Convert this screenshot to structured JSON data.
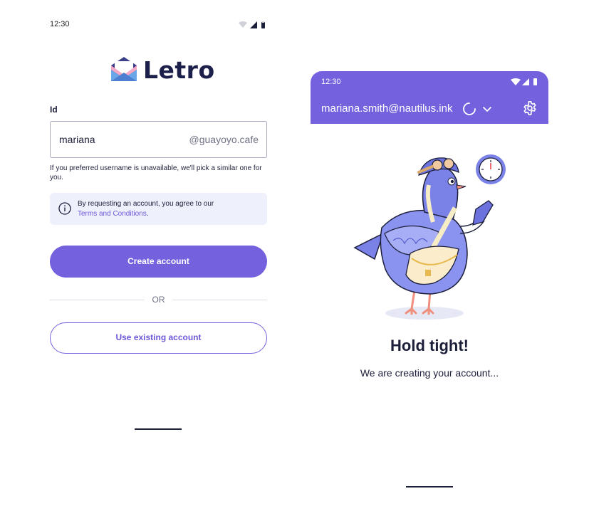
{
  "left_screen": {
    "status_bar": {
      "time": "12:30",
      "icons": [
        "wifi-icon",
        "signal-icon",
        "battery-icon"
      ]
    },
    "brand": {
      "name": "Letro"
    },
    "form": {
      "id_label": "Id",
      "username_value": "mariana",
      "domain_suffix": "@guayoyo.cafe",
      "helper_text": "If you preferred username is unavailable, we'll pick a similar one for you."
    },
    "notice": {
      "text": "By requesting an account, you agree to our",
      "link": "Terms and Conditions",
      "suffix": "."
    },
    "buttons": {
      "create": "Create account",
      "or": "OR",
      "existing": "Use existing account"
    }
  },
  "right_screen": {
    "status_bar": {
      "time": "12:30",
      "icons": [
        "wifi-icon",
        "signal-icon",
        "battery-icon"
      ]
    },
    "account_email": "mariana.smith@nautilus.ink",
    "heading": "Hold tight!",
    "message": "We are creating your account..."
  },
  "colors": {
    "accent": "#7361de",
    "accent_text": "#6b57d8",
    "notice_bg": "#eef0fc",
    "text": "#1c1f3a",
    "muted": "#6f7285"
  }
}
